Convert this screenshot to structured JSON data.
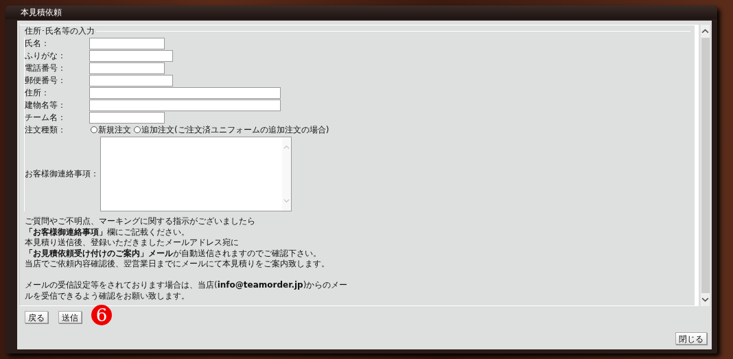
{
  "window": {
    "title": "本見積依頼"
  },
  "form": {
    "legend": "住所･氏名等の入力",
    "fields": [
      {
        "kind": "text",
        "label": "氏名："
      },
      {
        "kind": "text",
        "label": "ふりがな："
      },
      {
        "kind": "text",
        "label": "電話番号："
      },
      {
        "kind": "text",
        "label": "郵便番号："
      },
      {
        "kind": "text",
        "label": "住所："
      },
      {
        "kind": "text",
        "label": "建物名等："
      },
      {
        "kind": "text",
        "label": "チーム名："
      },
      {
        "kind": "radio",
        "label": "注文種類：",
        "options": [
          {
            "label": "新規注文",
            "selected": false
          },
          {
            "label": "追加注文(ご注文済ユニフォームの追加注文の場合)",
            "selected": false
          }
        ]
      },
      {
        "kind": "textarea",
        "label": "お客様御連絡事項："
      }
    ],
    "notes": [
      [
        "ご質問やご不明点、マーキングに関する指示がございましたら",
        "**「お客様御連絡事項」**欄にご記載ください。",
        "本見積り送信後、登録いただきましたメールアドレス宛に",
        "**「お見積依頼受け付けのご案内」メール**が自動送信されますのでご確認下さい。",
        "当店でご依頼内容確認後、翌営業日までにメールにて本見積りをご案内致します。"
      ],
      [
        "メールの受信設定等をされております場合は、当店(**info@teamorder.jp**)からのメー",
        "ルを受信できるよう確認をお願い致します。"
      ]
    ]
  },
  "buttons": [
    "戻る",
    "送信"
  ],
  "close_button": "閉じる",
  "badge": "6"
}
